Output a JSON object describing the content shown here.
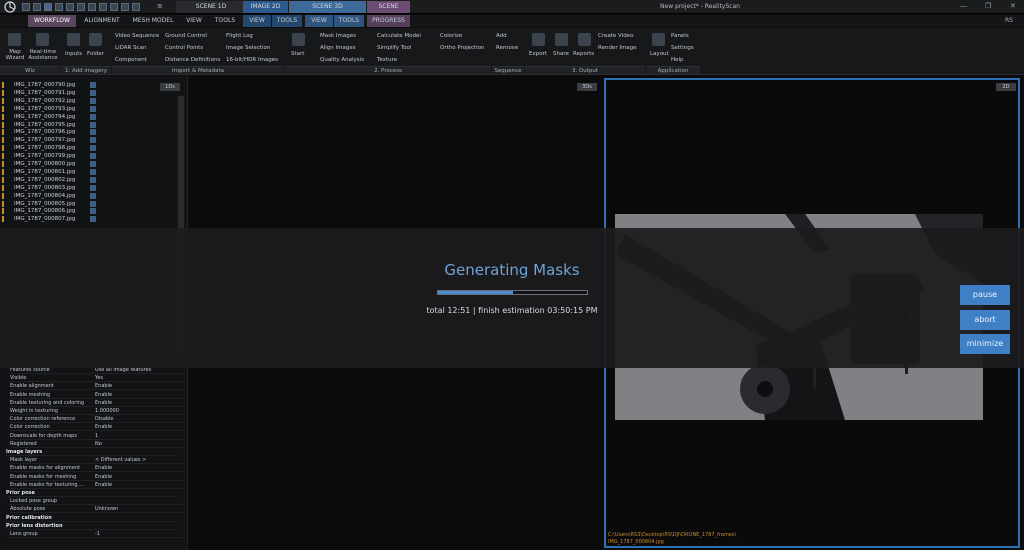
{
  "titlebar": {
    "tabs": [
      "SCENE 1D",
      "IMAGE 2D",
      "SCENE 3D",
      "SCENE"
    ],
    "project_title": "New project* - RealityScan"
  },
  "tabs": [
    "WORKFLOW",
    "ALIGNMENT",
    "MESH MODEL",
    "VIEW",
    "TOOLS",
    "VIEW",
    "TOOLS",
    "VIEW",
    "TOOLS",
    "PROGRESS"
  ],
  "user_initials": "RS",
  "ribbon": {
    "wiz": [
      "Map Wizard",
      "Real-time Assistance"
    ],
    "add_imagery": [
      "Inputs",
      "Folder"
    ],
    "import1": [
      "Video Sequence",
      "LiDAR Scan",
      "Component"
    ],
    "import2": [
      "Ground Control",
      "Control Points",
      "Distance Definitions"
    ],
    "import3": [
      "Flight Log",
      "Image Selection",
      "16-bit/HDR Images"
    ],
    "start": "Start",
    "process1": [
      "Mask Images",
      "Align Images",
      "Quality Analysis"
    ],
    "process2": [
      "Calculate Model",
      "Simplify Tool",
      "Texture"
    ],
    "process3": [
      "Colorize",
      "Ortho Projection"
    ],
    "sequence": [
      "Add",
      "Remove"
    ],
    "output1": [
      "Export",
      "Share",
      "Reports"
    ],
    "output2": [
      "Create Video",
      "Render Image"
    ],
    "layout": "Layout",
    "application": [
      "Panels",
      "Settings",
      "Help"
    ],
    "groups": [
      "Wiz",
      "1. Add imagery",
      "Import & Metadata",
      "2. Process",
      "Sequence",
      "3. Output",
      "Application"
    ]
  },
  "view_badges": {
    "left": "1Ds",
    "center": "3Ds",
    "right": "2D"
  },
  "files": [
    "IMG_1787_000790.jpg",
    "IMG_1787_000791.jpg",
    "IMG_1787_000792.jpg",
    "IMG_1787_000793.jpg",
    "IMG_1787_000794.jpg",
    "IMG_1787_000795.jpg",
    "IMG_1787_000796.jpg",
    "IMG_1787_000797.jpg",
    "IMG_1787_000798.jpg",
    "IMG_1787_000799.jpg",
    "IMG_1787_000800.jpg",
    "IMG_1787_000801.jpg",
    "IMG_1787_000802.jpg",
    "IMG_1787_000803.jpg",
    "IMG_1787_000804.jpg",
    "IMG_1787_000805.jpg",
    "IMG_1787_000806.jpg",
    "IMG_1787_000807.jpg"
  ],
  "properties": [
    {
      "label": "Features source",
      "value": "Use all image features"
    },
    {
      "label": "Visible",
      "value": "Yes"
    },
    {
      "label": "Enable alignment",
      "value": "Enable"
    },
    {
      "label": "Enable meshing",
      "value": "Enable"
    },
    {
      "label": "Enable texturing and coloring",
      "value": "Enable"
    },
    {
      "label": "Weight in texturing",
      "value": "1.000000"
    },
    {
      "label": "Color correction reference",
      "value": "Disable"
    },
    {
      "label": "Color correction",
      "value": "Enable"
    },
    {
      "label": "Downscale for depth maps",
      "value": "1"
    },
    {
      "label": "Registered",
      "value": "No"
    }
  ],
  "image_layers": {
    "section": "Image layers",
    "items": [
      {
        "label": "Mask layer",
        "value": "< Different values >"
      },
      {
        "label": "Enable masks for alignment",
        "value": "Enable"
      },
      {
        "label": "Enable masks for meshing",
        "value": "Enable"
      },
      {
        "label": "Enable masks for texturing ...",
        "value": "Enable"
      }
    ]
  },
  "prior_pose": {
    "section": "Prior pose",
    "items": [
      {
        "label": "Locked pose group",
        "value": ""
      },
      {
        "label": "Absolute pose",
        "value": "Unknown"
      }
    ]
  },
  "prior_calibration": "Prior calibration",
  "prior_lens": {
    "section": "Prior lens distortion",
    "items": [
      {
        "label": "Lens group",
        "value": "-1"
      }
    ]
  },
  "image_path": [
    "C:\\Users\\RS3\\Desktop\\RS\\DJI\\DRONE_1787_frames\\",
    "IMG_1787_000804.jpg"
  ],
  "progress": {
    "title": "Generating Masks",
    "fraction": 0.5,
    "estimate": "total 12:51 | finish estimation 03:50:15 PM",
    "buttons": [
      "pause",
      "abort",
      "minimize"
    ]
  },
  "colors": {
    "accent": "#4a8bd0",
    "title": "#6fa3d6",
    "active_tab": "#5b4660",
    "marker": "#d08a2a"
  }
}
